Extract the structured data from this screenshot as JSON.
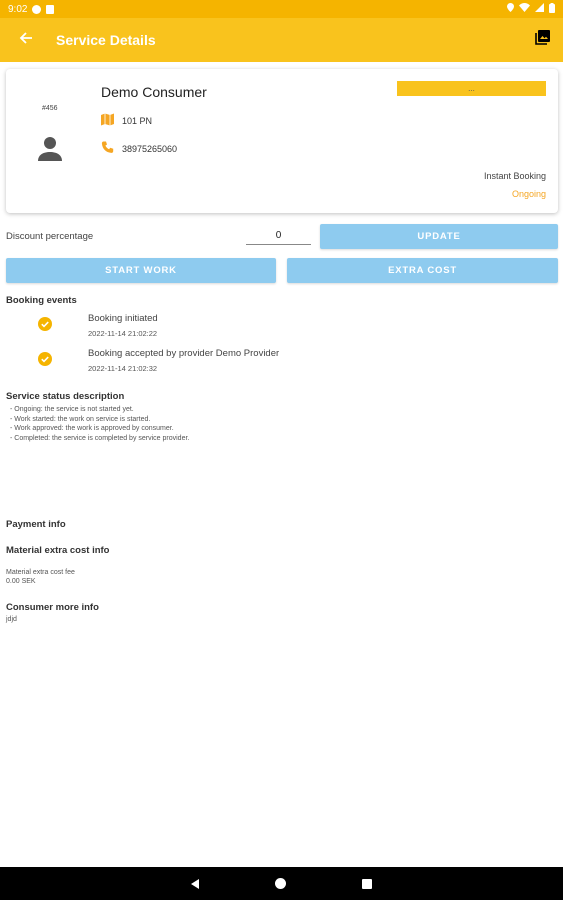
{
  "status_bar": {
    "time": "9:02"
  },
  "app_bar": {
    "title": "Service Details"
  },
  "card": {
    "code": "#456",
    "consumer_name": "Demo Consumer",
    "address": "101 PN",
    "phone": "38975265060",
    "tag": "...",
    "booking_type": "Instant Booking",
    "booking_status": "Ongoing"
  },
  "discount": {
    "label": "Discount percentage",
    "value": "0"
  },
  "buttons": {
    "update": "UPDATE",
    "start_work": "START WORK",
    "extra_cost": "EXTRA COST"
  },
  "booking_events": {
    "title": "Booking events",
    "items": [
      {
        "title": "Booking initiated",
        "time": "2022-11-14 21:02:22"
      },
      {
        "title": "Booking accepted by provider Demo Provider",
        "time": "2022-11-14 21:02:32"
      }
    ]
  },
  "status_description": {
    "title": "Service status description",
    "lines": [
      "- Ongoing: the service is not started yet.",
      "- Work started: the work on service is started.",
      "- Work approved: the work is approved by consumer.",
      "- Completed: the service is completed by service provider."
    ]
  },
  "payment_info": {
    "title": "Payment info"
  },
  "material_extra_cost": {
    "title": "Material extra cost info",
    "fee_label": "Material extra cost fee",
    "fee_value": "0.00 SEK"
  },
  "consumer_more_info": {
    "title": "Consumer more info",
    "value": "jdjd"
  },
  "colors": {
    "accent": "#f9c31d",
    "status_bar": "#f5b400",
    "button": "#8ecbef",
    "status_text": "#f5a623"
  }
}
